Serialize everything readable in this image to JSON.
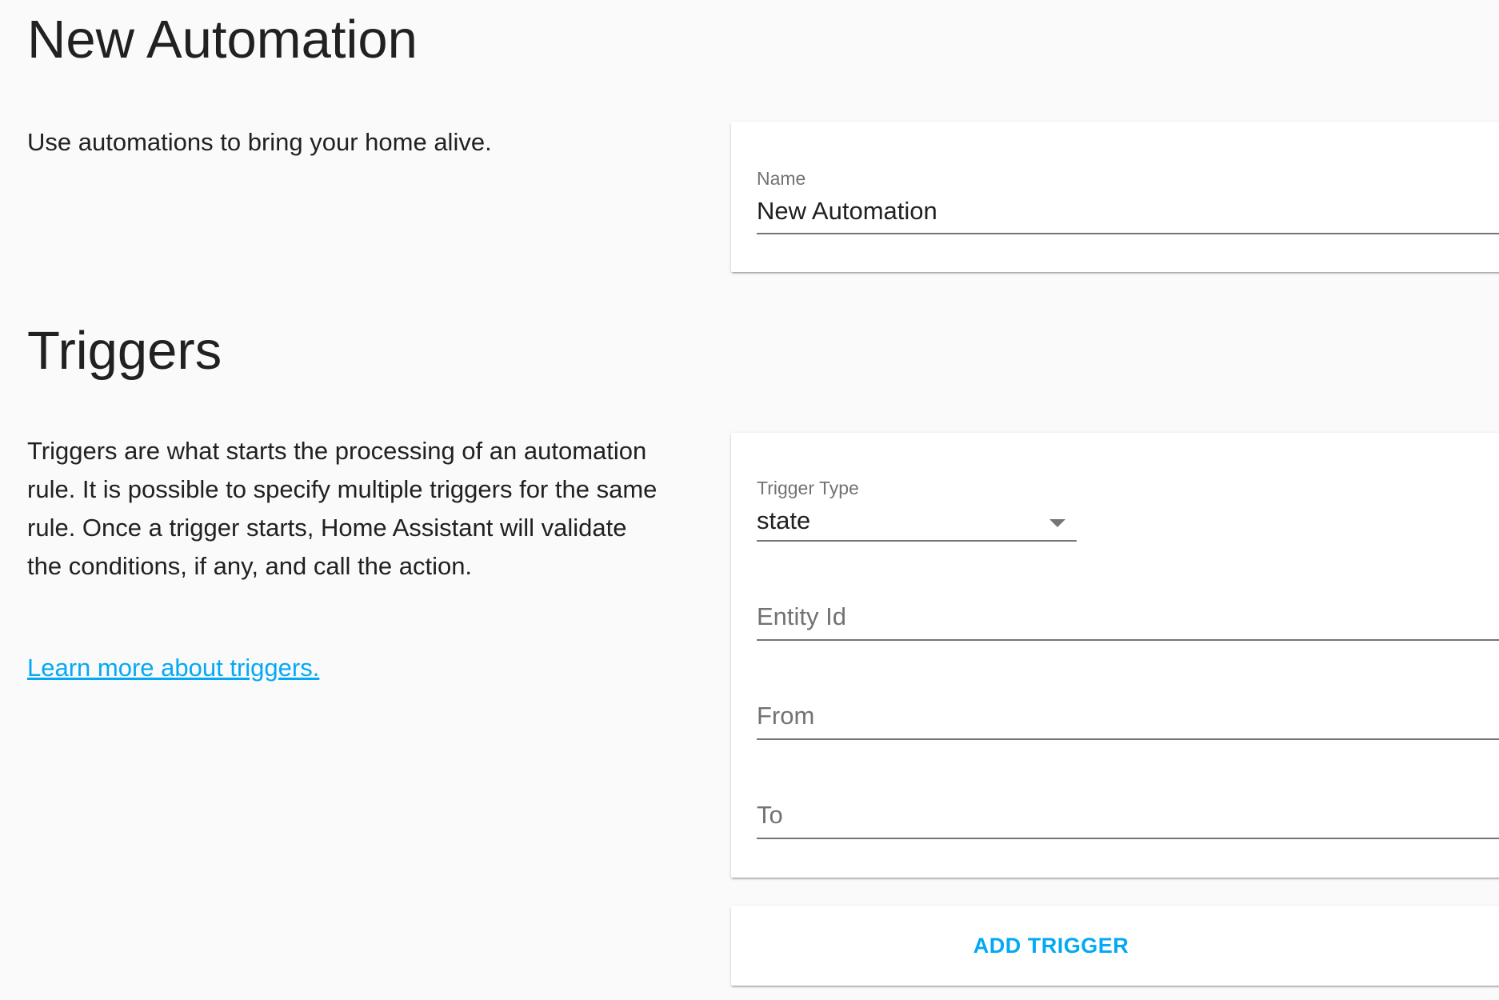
{
  "automation": {
    "title": "New Automation",
    "intro": "Use automations to bring your home alive.",
    "name_field": {
      "label": "Name",
      "value": "New Automation"
    }
  },
  "triggers": {
    "title": "Triggers",
    "description": "Triggers are what starts the processing of an automation rule. It is possible to specify multiple triggers for the same rule. Once a trigger starts, Home Assistant will validate the conditions, if any, and call the action.",
    "learn_more": "Learn more about triggers.",
    "trigger_type": {
      "label": "Trigger Type",
      "value": "state"
    },
    "entity_id": {
      "placeholder": "Entity Id"
    },
    "from": {
      "placeholder": "From"
    },
    "to": {
      "placeholder": "To"
    },
    "add_button": "ADD TRIGGER"
  },
  "colors": {
    "accent": "#03a9f4",
    "background": "#fafafa",
    "card": "#ffffff",
    "text_primary": "#212121",
    "text_secondary": "#737373"
  }
}
